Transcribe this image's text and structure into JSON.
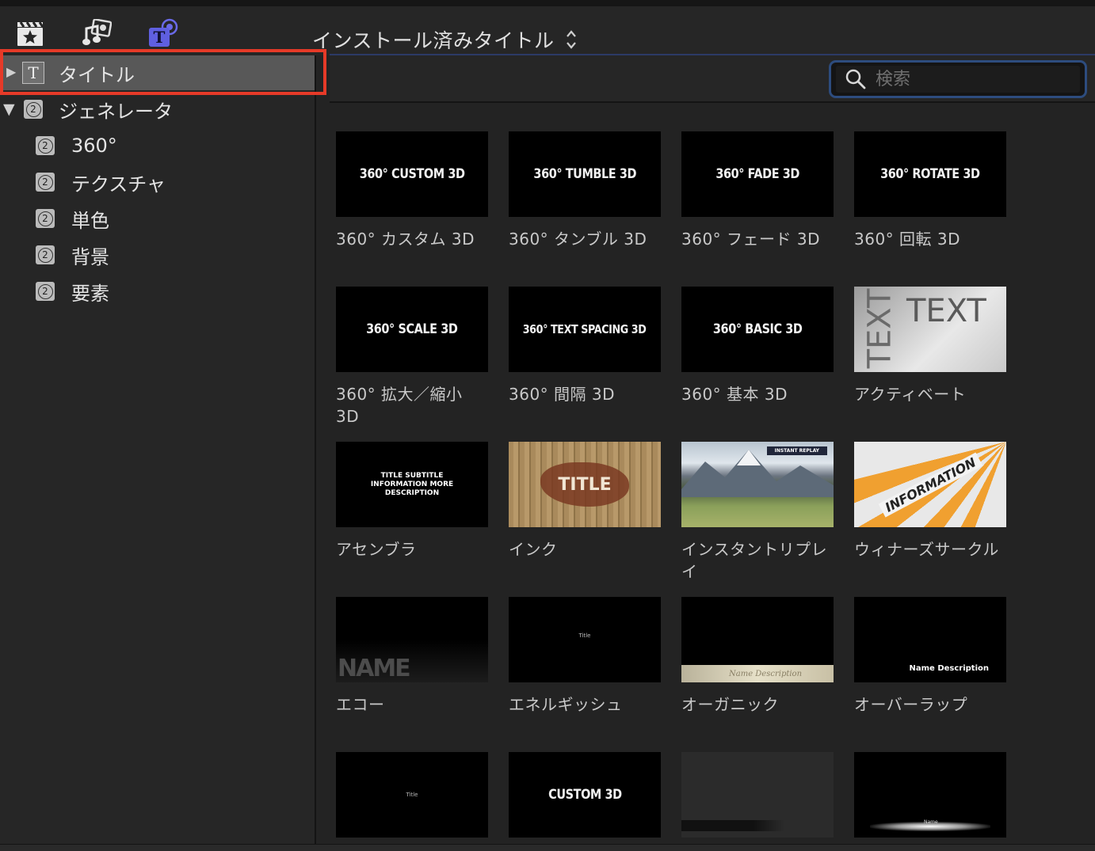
{
  "header": {
    "browser_title": "インストール済みタイトル",
    "icons": [
      "clapper-star-icon",
      "photo-music-icon",
      "titles-generators-icon"
    ]
  },
  "sidebar": {
    "titles_item": {
      "label": "タイトル",
      "expanded": false
    },
    "generators_item": {
      "label": "ジェネレータ",
      "expanded": true
    },
    "generator_children": [
      {
        "label": "360°"
      },
      {
        "label": "テクスチャ"
      },
      {
        "label": "単色"
      },
      {
        "label": "背景"
      },
      {
        "label": "要素"
      }
    ]
  },
  "search": {
    "placeholder": "検索",
    "value": ""
  },
  "tiles": [
    {
      "thumb_text": "360° CUSTOM 3D",
      "label": "360° カスタム 3D"
    },
    {
      "thumb_text": "360° TUMBLE 3D",
      "label": "360° タンブル 3D"
    },
    {
      "thumb_text": "360° FADE 3D",
      "label": "360° フェード 3D"
    },
    {
      "thumb_text": "360° ROTATE 3D",
      "label": "360° 回転 3D"
    },
    {
      "thumb_text": "360° SCALE 3D",
      "label": "360° 拡大／縮小 3D"
    },
    {
      "thumb_text": "360° TEXT SPACING 3D",
      "label": "360° 間隔 3D"
    },
    {
      "thumb_text": "360° BASIC 3D",
      "label": "360° 基本 3D"
    },
    {
      "thumb_text": "TEXT",
      "label": "アクティベート"
    },
    {
      "thumb_text": "TITLE SUBTITLE INFORMATION MORE DESCRIPTION",
      "label": "アセンブラ"
    },
    {
      "thumb_text": "TITLE",
      "label": "インク"
    },
    {
      "thumb_text": "INSTANT REPLAY",
      "label": "インスタントリプレイ"
    },
    {
      "thumb_text": "INFORMATION",
      "label": "ウィナーズサークル"
    },
    {
      "thumb_text": "NAME",
      "label": "エコー"
    },
    {
      "thumb_text": "Title",
      "label": "エネルギッシュ"
    },
    {
      "thumb_text": "Name Description",
      "label": "オーガニック"
    },
    {
      "thumb_text": "Name Description",
      "label": "オーバーラップ"
    },
    {
      "thumb_text": "Title",
      "label": ""
    },
    {
      "thumb_text": "CUSTOM 3D",
      "label": ""
    },
    {
      "thumb_text": "",
      "label": ""
    },
    {
      "thumb_text": "Name",
      "label": ""
    }
  ]
}
